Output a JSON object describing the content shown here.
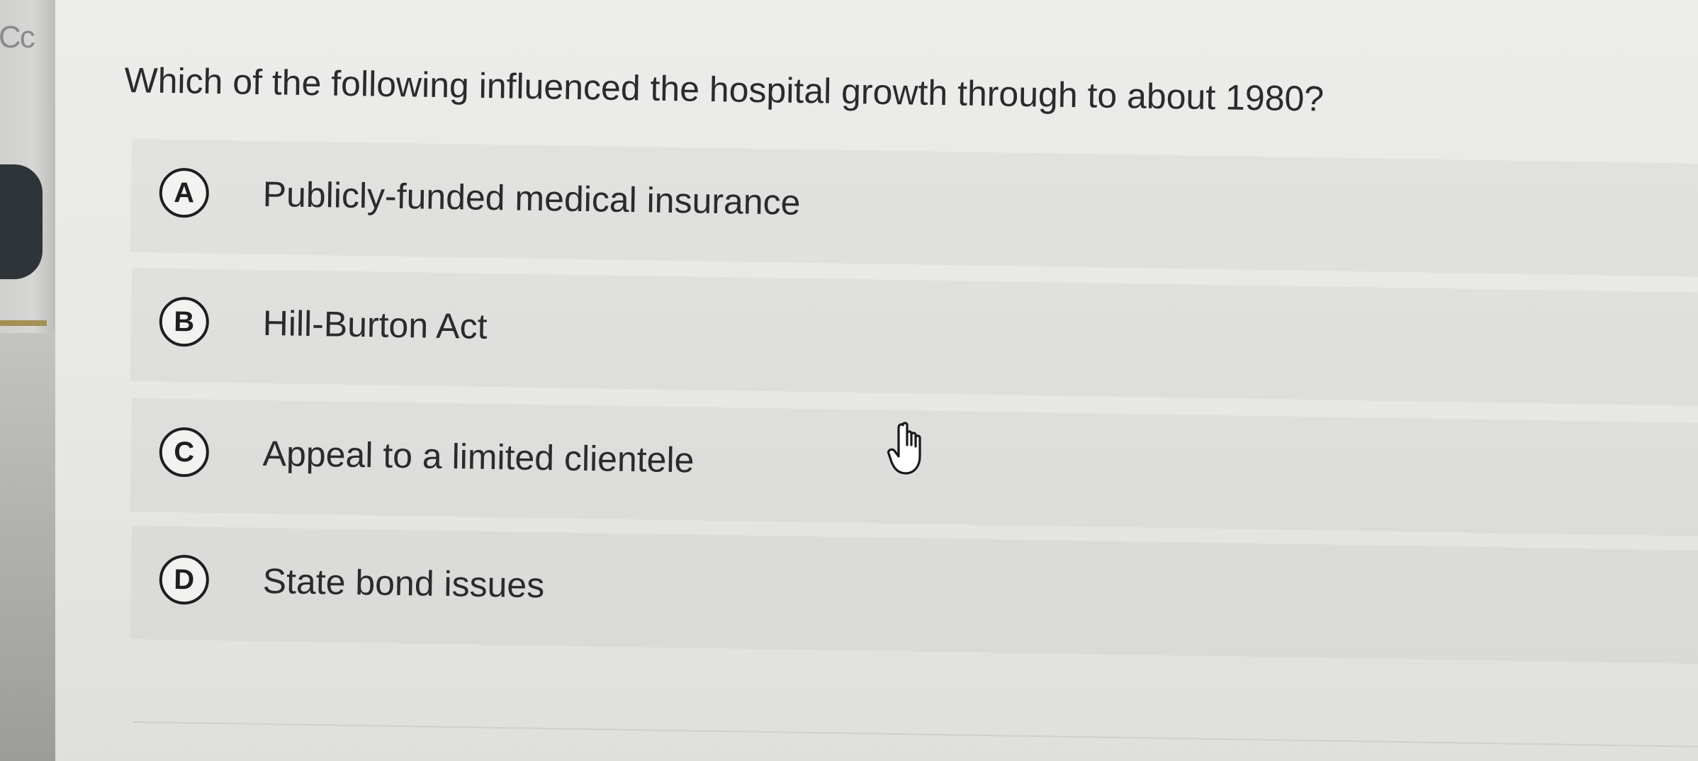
{
  "left_panel": {
    "cut_text": "Cc"
  },
  "question": {
    "text": "Which of the following influenced the hospital growth through to about 1980?"
  },
  "options": [
    {
      "letter": "A",
      "text": "Publicly-funded medical insurance"
    },
    {
      "letter": "B",
      "text": "Hill-Burton Act"
    },
    {
      "letter": "C",
      "text": "Appeal to a limited clientele"
    },
    {
      "letter": "D",
      "text": "State bond issues"
    }
  ],
  "cursor": {
    "icon": "hand-pointer-icon"
  }
}
